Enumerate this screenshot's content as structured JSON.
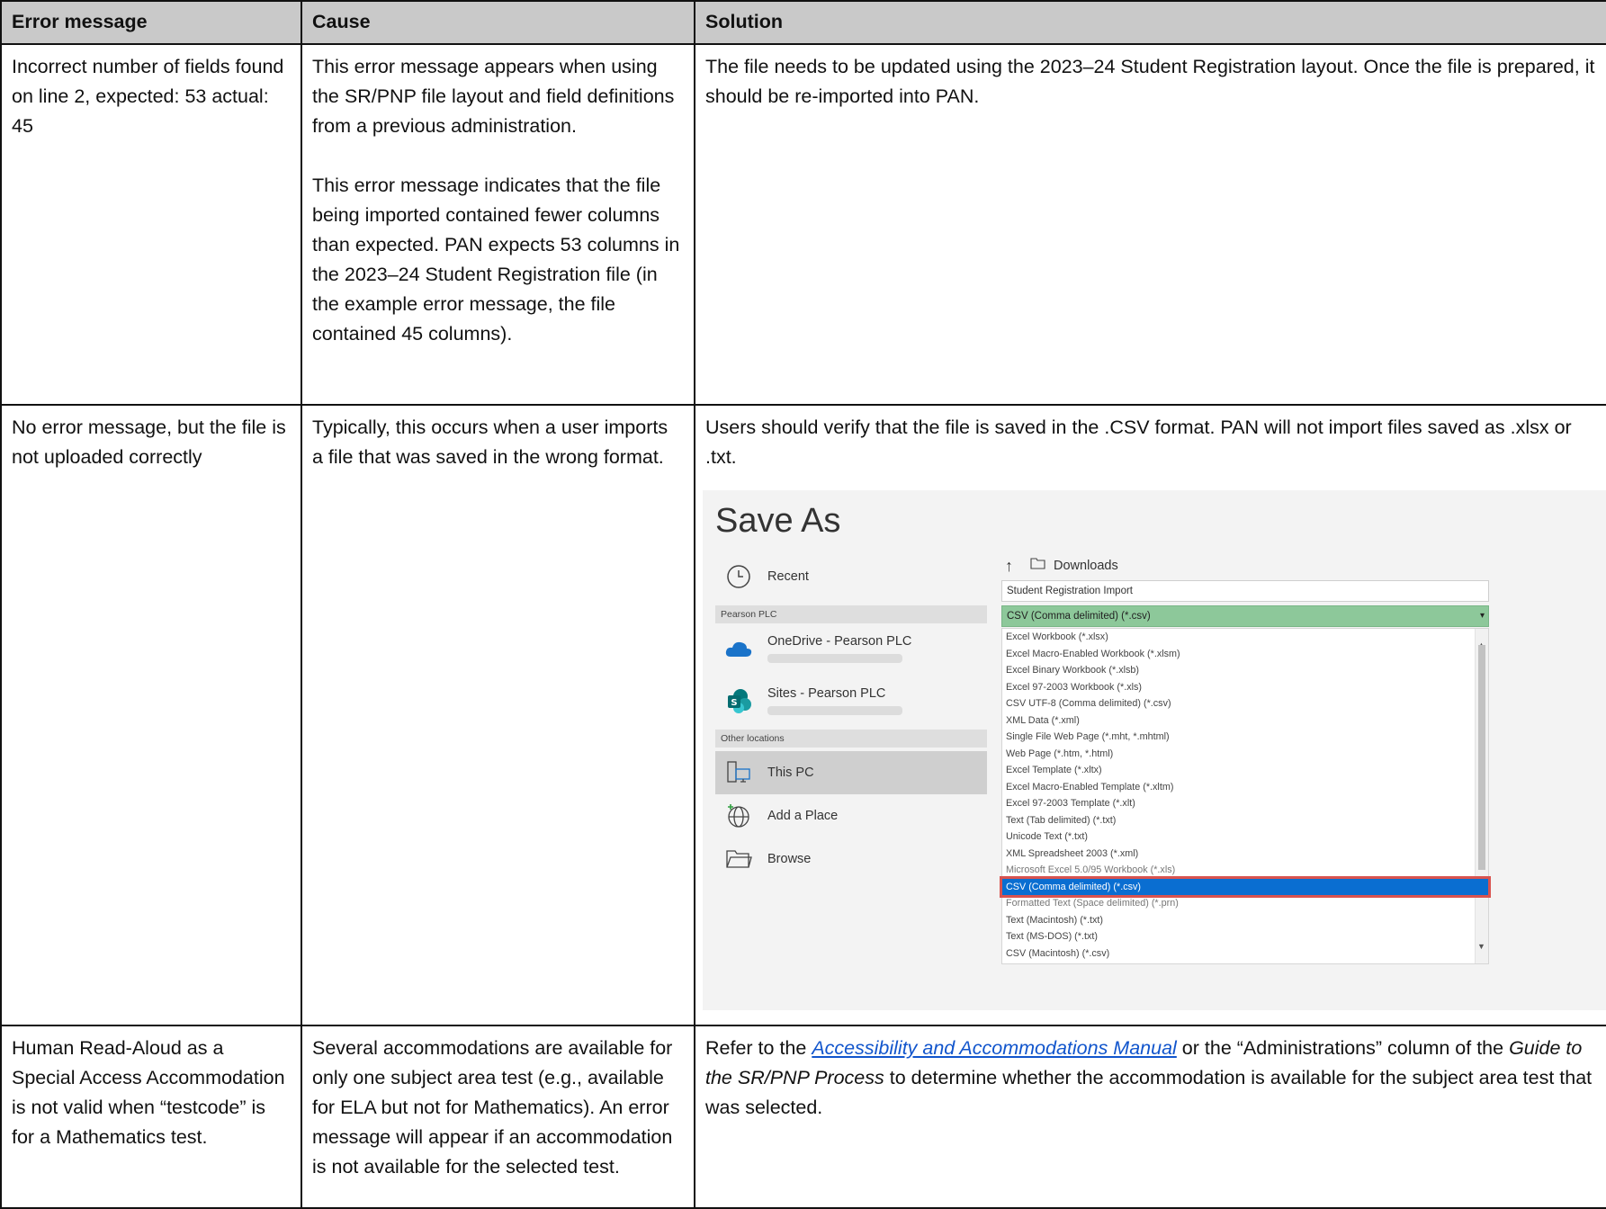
{
  "headers": {
    "error": "Error message",
    "cause": "Cause",
    "solution": "Solution"
  },
  "row1": {
    "error": "Incorrect number of fields found on line 2, expected: 53 actual: 45",
    "cause_p1": "This error message appears when using the SR/PNP file layout and field definitions from a previous administration.",
    "cause_p2": "This error message indicates that the file being imported contained fewer columns than expected. PAN expects 53 columns in the 2023–24 Student Registration file (in the example error message, the file contained 45 columns).",
    "solution": "The file needs to be updated using the 2023–24 Student Registration layout. Once the file is prepared, it should be re-imported into PAN."
  },
  "row2": {
    "error": "No error message, but the file is not uploaded correctly",
    "cause": "Typically, this occurs when a user imports a file that was saved in the wrong format.",
    "solution": "Users should verify that the file is saved in the .CSV format. PAN will not import files saved as .xlsx or .txt."
  },
  "saveas": {
    "title": "Save As",
    "recent": "Recent",
    "group_pearson": "Pearson PLC",
    "onedrive": "OneDrive - Pearson PLC",
    "sites": "Sites - Pearson PLC",
    "group_other": "Other locations",
    "this_pc": "This PC",
    "add_place": "Add a Place",
    "browse": "Browse",
    "location": "Downloads",
    "filename": "Student Registration Import",
    "filetype": "CSV (Comma delimited) (*.csv)",
    "options": [
      "Excel Workbook (*.xlsx)",
      "Excel Macro-Enabled Workbook (*.xlsm)",
      "Excel Binary Workbook (*.xlsb)",
      "Excel 97-2003 Workbook (*.xls)",
      "CSV UTF-8 (Comma delimited) (*.csv)",
      "XML Data (*.xml)",
      "Single File Web Page (*.mht, *.mhtml)",
      "Web Page (*.htm, *.html)",
      "Excel Template (*.xltx)",
      "Excel Macro-Enabled Template (*.xltm)",
      "Excel 97-2003 Template (*.xlt)",
      "Text (Tab delimited) (*.txt)",
      "Unicode Text (*.txt)",
      "XML Spreadsheet 2003 (*.xml)",
      "Microsoft Excel 5.0/95 Workbook (*.xls)",
      "CSV (Comma delimited) (*.csv)",
      "Formatted Text (Space delimited) (*.prn)",
      "Text (Macintosh) (*.txt)",
      "Text (MS-DOS) (*.txt)",
      "CSV (Macintosh) (*.csv)"
    ],
    "highlighted_index": 15
  },
  "row3": {
    "error": "Human Read-Aloud as a Special Access Accommodation is not valid when “testcode” is for a Mathematics test.",
    "cause": "Several accommodations are available for only one subject area test (e.g., available for ELA but not for Mathematics). An error message will appear if an accommodation is not available for the selected test.",
    "solution_pre": "Refer to the ",
    "solution_link": "Accessibility and Accommodations Manual",
    "solution_mid": " or the “Administrations” column of the ",
    "solution_em": "Guide to the SR/PNP Process",
    "solution_post": " to determine whether the accommodation is available for the subject area test that was selected."
  },
  "colors": {
    "header_bg": "#c9c9c9",
    "link": "#1155cc",
    "highlight": "#0a6ed1",
    "highlight_border": "#d9534f",
    "filetype_bg": "#8dc89a"
  }
}
